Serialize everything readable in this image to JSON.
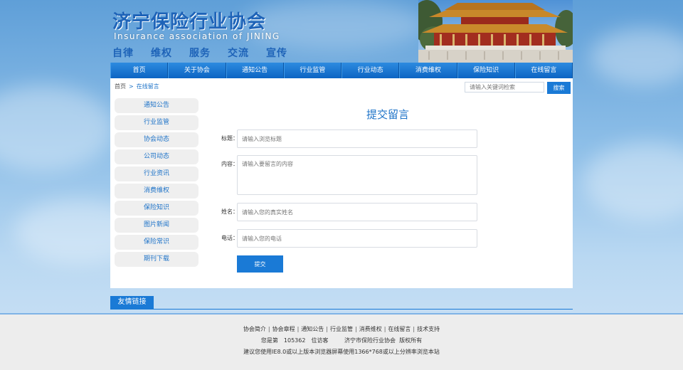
{
  "header": {
    "title": "济宁保险行业协会",
    "subtitle": "Insurance association of JINING",
    "motto": [
      "自律",
      "维权",
      "服务",
      "交流",
      "宣传"
    ]
  },
  "nav": {
    "items": [
      "首页",
      "关于协会",
      "通知公告",
      "行业监管",
      "行业动态",
      "消费维权",
      "保险知识",
      "在线留言"
    ]
  },
  "breadcrumb": {
    "home": "首页",
    "separator": ">",
    "current": "在线留言"
  },
  "search": {
    "placeholder": "请输入关键词检索",
    "button_label": "搜索"
  },
  "sidebar": {
    "items": [
      "通知公告",
      "行业监管",
      "协会动态",
      "公司动态",
      "行业资讯",
      "消费维权",
      "保险知识",
      "图片新闻",
      "保险常识",
      "期刊下载"
    ]
  },
  "form": {
    "title": "提交留言",
    "title_label": "标题：",
    "title_placeholder": "请输入浏览标题",
    "content_label": "内容：",
    "content_placeholder": "请输入要留言的内容",
    "name_label": "姓名：",
    "name_placeholder": "请输入您的真实姓名",
    "phone_label": "电话：",
    "phone_placeholder": "请输入您的电话",
    "submit_label": "提交"
  },
  "friendly_links": {
    "label": "友情链接"
  },
  "footer": {
    "links": [
      "协会简介",
      "协会章程",
      "通知公告",
      "行业监管",
      "消费维权",
      "在线留言",
      "技术支持"
    ],
    "link_separator": "|",
    "visitor_prefix": "您是第",
    "visitor_count": "105362",
    "visitor_suffix": "位访客",
    "copyright": "济宁市保险行业协会  版权所有",
    "browser_note": "建议您使用IE8.0或以上版本浏览器屏幕使用1366*768或以上分辨率浏览本站"
  },
  "colors": {
    "brand_blue": "#1a7ad6",
    "nav_top": "#2d8be0",
    "nav_bottom": "#0c64c3",
    "title_blue": "#1e63b8"
  }
}
